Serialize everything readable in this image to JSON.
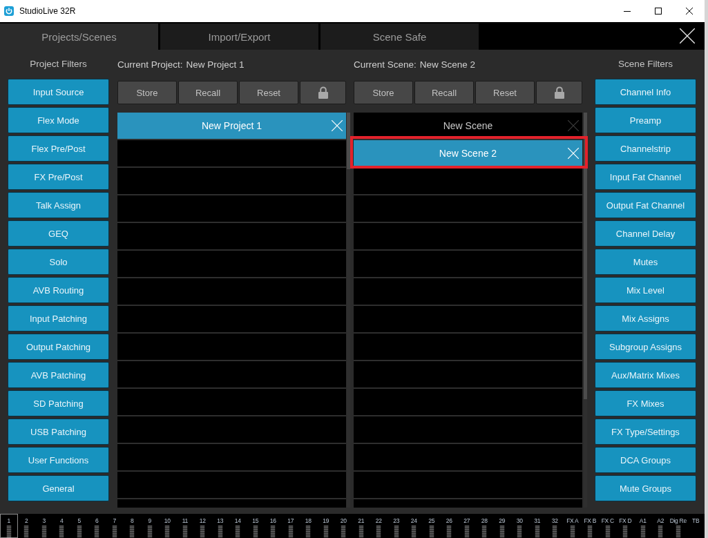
{
  "window": {
    "title": "StudioLive 32R"
  },
  "tabs": [
    {
      "label": "Projects/Scenes",
      "selected": true
    },
    {
      "label": "Import/Export",
      "selected": false
    },
    {
      "label": "Scene Safe",
      "selected": false
    }
  ],
  "project_filters": {
    "title": "Project Filters",
    "items": [
      "Input Source",
      "Flex Mode",
      "Flex Pre/Post",
      "FX Pre/Post",
      "Talk Assign",
      "GEQ",
      "Solo",
      "AVB Routing",
      "Input Patching",
      "Output Patching",
      "AVB Patching",
      "SD Patching",
      "USB Patching",
      "User Functions",
      "General"
    ]
  },
  "current_project": {
    "label": "Current Project:",
    "value": "New Project 1",
    "buttons": [
      "Store",
      "Recall",
      "Reset"
    ]
  },
  "projects": [
    {
      "name": "New Project 1",
      "selected": true,
      "highlighted": false
    }
  ],
  "current_scene": {
    "label": "Current Scene:",
    "value": "New Scene 2",
    "buttons": [
      "Store",
      "Recall",
      "Reset"
    ]
  },
  "scenes": [
    {
      "name": "New Scene",
      "selected": false,
      "highlighted": false
    },
    {
      "name": "New Scene 2",
      "selected": true,
      "highlighted": true
    }
  ],
  "scene_filters": {
    "title": "Scene Filters",
    "items": [
      "Channel Info",
      "Preamp",
      "Channelstrip",
      "Input Fat Channel",
      "Output Fat Channel",
      "Channel Delay",
      "Mutes",
      "Mix Level",
      "Mix Assigns",
      "Subgroup Assigns",
      "Aux/Matrix Mixes",
      "FX Mixes",
      "FX Type/Settings",
      "DCA Groups",
      "Mute Groups"
    ]
  },
  "channels": [
    {
      "label": "1",
      "selected": true,
      "meter": true
    },
    {
      "label": "2",
      "selected": false,
      "meter": true
    },
    {
      "label": "3",
      "selected": false,
      "meter": true
    },
    {
      "label": "4",
      "selected": false,
      "meter": true
    },
    {
      "label": "5",
      "selected": false,
      "meter": true
    },
    {
      "label": "6",
      "selected": false,
      "meter": true
    },
    {
      "label": "7",
      "selected": false,
      "meter": true
    },
    {
      "label": "8",
      "selected": false,
      "meter": true
    },
    {
      "label": "9",
      "selected": false,
      "meter": true
    },
    {
      "label": "10",
      "selected": false,
      "meter": true
    },
    {
      "label": "11",
      "selected": false,
      "meter": true
    },
    {
      "label": "12",
      "selected": false,
      "meter": true
    },
    {
      "label": "13",
      "selected": false,
      "meter": true
    },
    {
      "label": "14",
      "selected": false,
      "meter": true
    },
    {
      "label": "15",
      "selected": false,
      "meter": true
    },
    {
      "label": "16",
      "selected": false,
      "meter": true
    },
    {
      "label": "17",
      "selected": false,
      "meter": true
    },
    {
      "label": "18",
      "selected": false,
      "meter": true
    },
    {
      "label": "19",
      "selected": false,
      "meter": true
    },
    {
      "label": "20",
      "selected": false,
      "meter": true
    },
    {
      "label": "21",
      "selected": false,
      "meter": true
    },
    {
      "label": "22",
      "selected": false,
      "meter": true
    },
    {
      "label": "23",
      "selected": false,
      "meter": true
    },
    {
      "label": "24",
      "selected": false,
      "meter": true
    },
    {
      "label": "25",
      "selected": false,
      "meter": true
    },
    {
      "label": "26",
      "selected": false,
      "meter": true
    },
    {
      "label": "27",
      "selected": false,
      "meter": true
    },
    {
      "label": "28",
      "selected": false,
      "meter": true
    },
    {
      "label": "29",
      "selected": false,
      "meter": true
    },
    {
      "label": "30",
      "selected": false,
      "meter": true
    },
    {
      "label": "31",
      "selected": false,
      "meter": true
    },
    {
      "label": "32",
      "selected": false,
      "meter": true
    },
    {
      "label": "FX A",
      "selected": false,
      "meter": true
    },
    {
      "label": "FX B",
      "selected": false,
      "meter": true
    },
    {
      "label": "FX C",
      "selected": false,
      "meter": true
    },
    {
      "label": "FX D",
      "selected": false,
      "meter": true
    },
    {
      "label": "A1",
      "selected": false,
      "meter": true
    },
    {
      "label": "A2",
      "selected": false,
      "meter": true
    },
    {
      "label": "Dig Re",
      "selected": false,
      "meter": true
    },
    {
      "label": "TB",
      "selected": false,
      "meter": false
    }
  ]
}
